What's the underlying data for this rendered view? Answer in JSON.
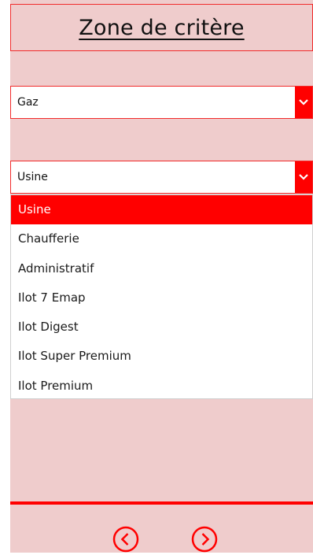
{
  "header": {
    "title": "Zone de critère"
  },
  "selects": {
    "energy": {
      "value": "Gaz"
    },
    "zone": {
      "value": "Usine"
    }
  },
  "zone_options": [
    "Usine",
    "Chaufferie",
    "Administratif",
    "Ilot 7 Emap",
    "Ilot Digest",
    "Ilot Super Premium",
    "Ilot Premium"
  ],
  "colors": {
    "accent": "#ff0000",
    "panel": "#efcccc",
    "border": "#f12b2b"
  },
  "icons": {
    "dropdown": "chevron-down-icon",
    "prev": "chevron-left-circle-icon",
    "next": "chevron-right-circle-icon"
  }
}
